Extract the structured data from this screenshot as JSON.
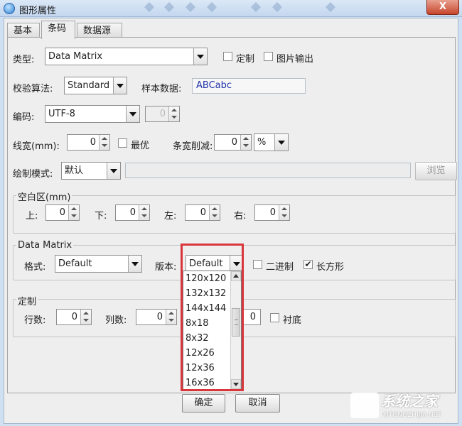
{
  "window": {
    "title": "图形属性",
    "close_label": "X"
  },
  "tabs": [
    {
      "label": "基本",
      "active": false
    },
    {
      "label": "条码",
      "active": true
    },
    {
      "label": "数据源",
      "active": false
    }
  ],
  "type_row": {
    "label": "类型:",
    "value": "Data Matrix",
    "custom_label": "定制",
    "image_output_label": "图片输出"
  },
  "check_row": {
    "label": "校验算法:",
    "value": "Standard",
    "sample_label": "样本数据:",
    "sample_value": "ABCabc"
  },
  "encoding_row": {
    "label": "编码:",
    "value": "UTF-8",
    "extra_value": "0"
  },
  "linewidth_row": {
    "label": "线宽(mm):",
    "value": "0",
    "optimal_label": "最优",
    "bar_reduce_label": "条宽削减:",
    "bar_reduce_value": "0",
    "unit": "%"
  },
  "draw_mode_row": {
    "label": "绘制模式:",
    "value": "默认",
    "browse_label": "浏览"
  },
  "quiet_zone": {
    "title": "空白区(mm)",
    "top_label": "上:",
    "top_value": "0",
    "bottom_label": "下:",
    "bottom_value": "0",
    "left_label": "左:",
    "left_value": "0",
    "right_label": "右:",
    "right_value": "0"
  },
  "data_matrix": {
    "title": "Data Matrix",
    "format_label": "格式:",
    "format_value": "Default",
    "version_label": "版本:",
    "version_value": "Default",
    "binary_label": "二进制",
    "rectangle_label": "长方形",
    "rectangle_checked": "✔"
  },
  "custom_group": {
    "title": "定制",
    "rows_label": "行数:",
    "rows_value": "0",
    "cols_label": "列数:",
    "cols_value": "0",
    "third_value": "0",
    "background_label": "衬底"
  },
  "version_dropdown": {
    "items": [
      "120x120",
      "132x132",
      "144x144",
      "8x18",
      "8x32",
      "12x26",
      "12x36",
      "16x36"
    ]
  },
  "footer": {
    "ok_label": "确定",
    "cancel_label": "取消"
  },
  "watermark": {
    "text": "系统之家",
    "sub": "XITONGZHIJIA.NET"
  },
  "colors": {
    "highlight": "#d9363b",
    "sample_text": "#2233aa"
  }
}
